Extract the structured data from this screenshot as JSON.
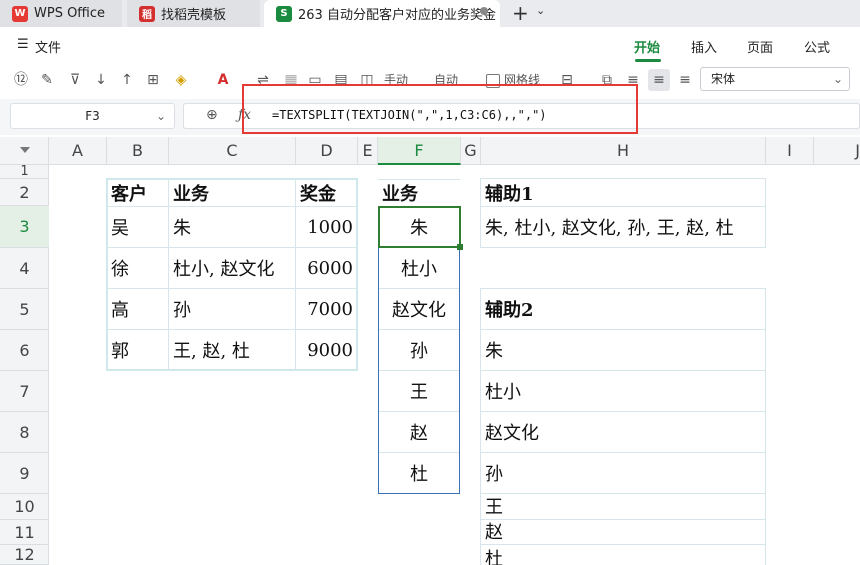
{
  "tabs": [
    {
      "label": "WPS Office",
      "logo": "W",
      "color": "#e53935"
    },
    {
      "label": "找稻壳模板",
      "logo": "稻",
      "color": "#d32f2f"
    },
    {
      "label": "263 自动分配客户对应的业务奖金",
      "logo": "S",
      "color": "#1b8b3f"
    }
  ],
  "menu": {
    "file": "文件",
    "items": [
      "开始",
      "插入",
      "页面",
      "公式"
    ]
  },
  "toolbar": {
    "manual": "手动",
    "auto": "自动",
    "gridlines": "网格线",
    "font": "宋体"
  },
  "namebox": "F3",
  "formula": "=TEXTSPLIT(TEXTJOIN(\",\",1,C3:C6),,\",\")",
  "columns": [
    "A",
    "B",
    "C",
    "D",
    "E",
    "F",
    "G",
    "H",
    "I",
    "J"
  ],
  "rows": [
    "1",
    "2",
    "3",
    "4",
    "5",
    "6",
    "7",
    "8",
    "9",
    "10",
    "11",
    "12"
  ],
  "table": {
    "headers": [
      "客户",
      "业务",
      "奖金"
    ],
    "rows": [
      [
        "吴",
        "朱",
        "1000"
      ],
      [
        "徐",
        "杜小, 赵文化",
        "6000"
      ],
      [
        "高",
        "孙",
        "7000"
      ],
      [
        "郭",
        "王, 赵, 杜",
        "9000"
      ]
    ]
  },
  "fcolumn": {
    "header": "业务",
    "values": [
      "朱",
      "杜小",
      "赵文化",
      "孙",
      "王",
      "赵",
      "杜"
    ]
  },
  "helper1": {
    "header": "辅助1",
    "value": "朱, 杜小, 赵文化, 孙, 王, 赵, 杜"
  },
  "helper2": {
    "header": "辅助2",
    "values": [
      "朱",
      "杜小",
      "赵文化",
      "孙",
      "王",
      "赵",
      "杜"
    ]
  }
}
